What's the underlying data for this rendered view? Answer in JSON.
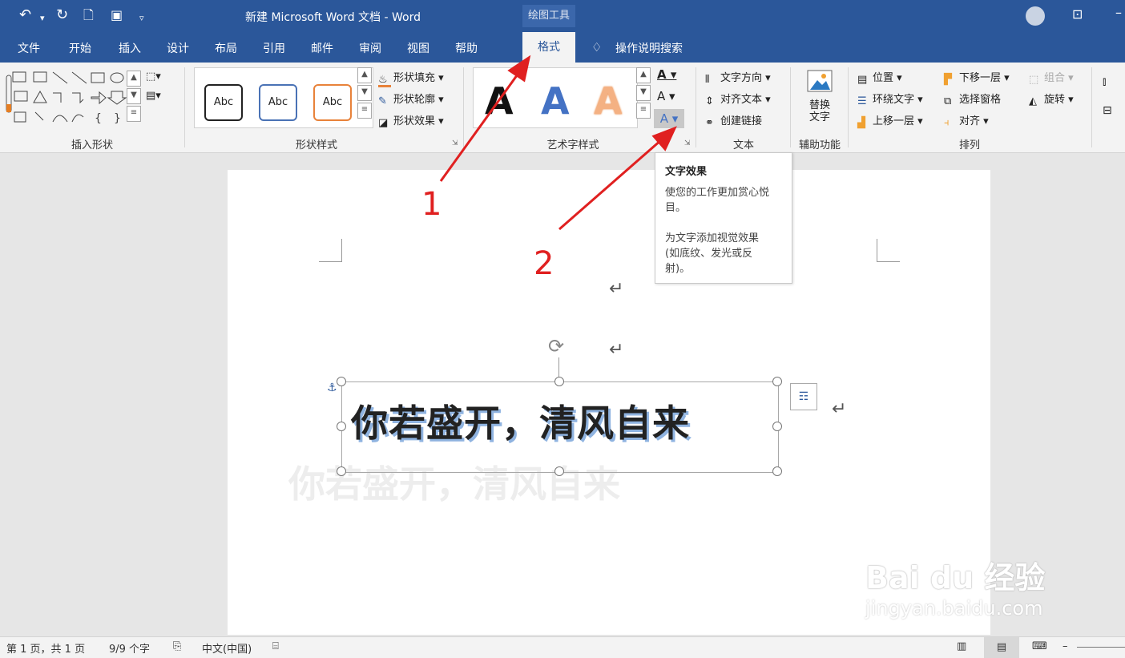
{
  "window": {
    "title": "新建 Microsoft Word 文档 - Word",
    "context_tool": "绘图工具"
  },
  "tabs": [
    "文件",
    "开始",
    "插入",
    "设计",
    "布局",
    "引用",
    "邮件",
    "审阅",
    "视图",
    "帮助",
    "格式"
  ],
  "search_label": "操作说明搜索",
  "ribbon": {
    "groups": [
      "插入形状",
      "形状样式",
      "艺术字样式",
      "文本",
      "辅助功能",
      "排列"
    ],
    "shape_style_samples": [
      "Abc",
      "Abc",
      "Abc"
    ],
    "shape_fill": "形状填充",
    "shape_outline": "形状轮廓",
    "shape_effects": "形状效果",
    "wordart_samples": [
      "A",
      "A",
      "A"
    ],
    "text_direction": "文字方向",
    "align_text": "对齐文本",
    "create_link": "创建链接",
    "alt_text_line1": "替换",
    "alt_text_line2": "文字",
    "position": "位置",
    "wrap_text": "环绕文字",
    "bring_forward": "上移一层",
    "send_backward": "下移一层",
    "selection_pane": "选择窗格",
    "align": "对齐",
    "group": "组合",
    "rotate": "旋转"
  },
  "tooltip": {
    "title": "文字效果",
    "lines": [
      "使您的工作更加赏心悦",
      "目。",
      "为文字添加视觉效果",
      "(如底纹、发光或反",
      "射)。"
    ]
  },
  "document": {
    "wordart_text": "你若盛开，清风自来",
    "paragraph_mark": "↵"
  },
  "annotations": [
    "1",
    "2"
  ],
  "status": {
    "page": "第 1 页，共 1 页",
    "words": "9/9 个字",
    "language": "中文(中国)"
  },
  "watermark": {
    "brand": "Bai du 经验",
    "url": "jingyan.baidu.com"
  },
  "colors": {
    "accent": "#2b579a",
    "annotation": "#e02020",
    "wordart_shadow": "#8fb3e0"
  }
}
